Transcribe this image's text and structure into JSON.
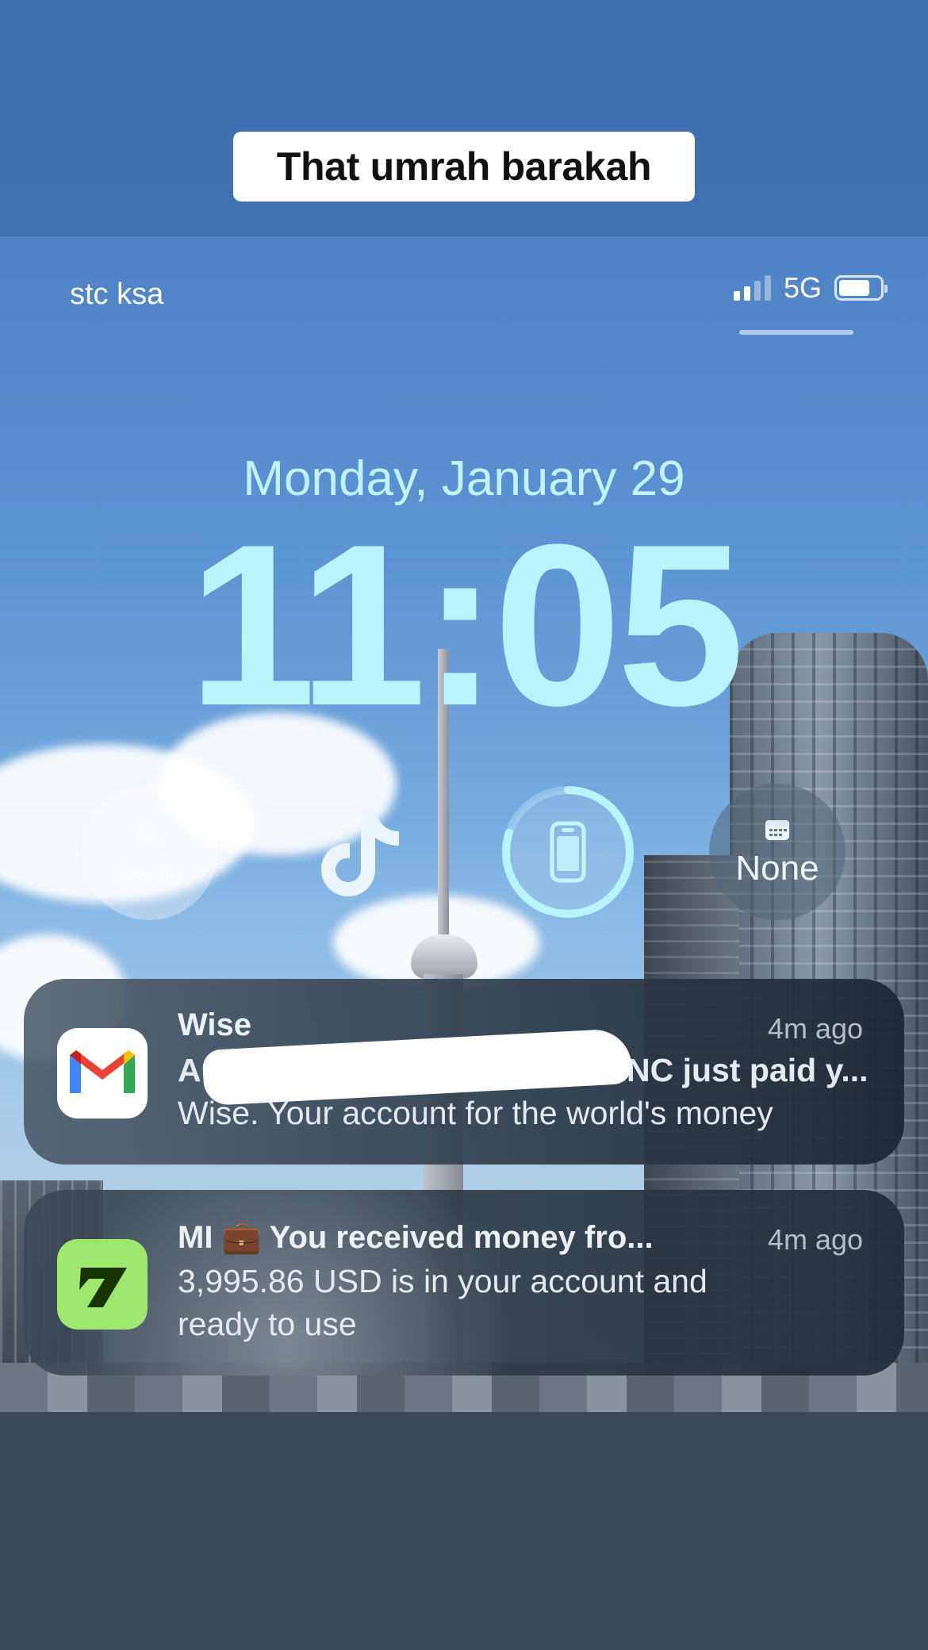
{
  "caption": "That umrah barakah",
  "status_bar": {
    "carrier": "stc ksa",
    "network": "5G",
    "signal_bars_active": 2,
    "signal_bars_total": 4,
    "battery_level": 0.75
  },
  "lock_screen": {
    "date": "Monday, January 29",
    "time": "11:05"
  },
  "widgets": [
    {
      "name": "weather",
      "icon": "search-icon",
      "label": "Seville"
    },
    {
      "name": "tiktok",
      "icon": "tiktok-icon"
    },
    {
      "name": "device-battery",
      "icon": "phone-icon",
      "level": 0.8
    },
    {
      "name": "calendar",
      "icon": "calendar-icon",
      "label": "None"
    }
  ],
  "notifications": [
    {
      "app_icon": "gmail-icon",
      "title": "Wise",
      "time": "4m ago",
      "line1": "A… INC just paid y...",
      "line1_visible_suffix": "INC just paid y...",
      "line1_prefix": "A",
      "line2": "Wise. Your account for the world's money"
    },
    {
      "app_icon": "wise-icon",
      "title": "MI 💼 You received money fro...",
      "time": "4m ago",
      "line1": "3,995.86 USD is in your account and",
      "line2": "ready to use"
    }
  ],
  "colors": {
    "clock": "#b8f4fb",
    "wise_green": "#9fe870",
    "gmail_red": "#ea4335",
    "gmail_blue": "#4285f4",
    "gmail_green": "#34a853",
    "gmail_yellow": "#fbbc05"
  }
}
